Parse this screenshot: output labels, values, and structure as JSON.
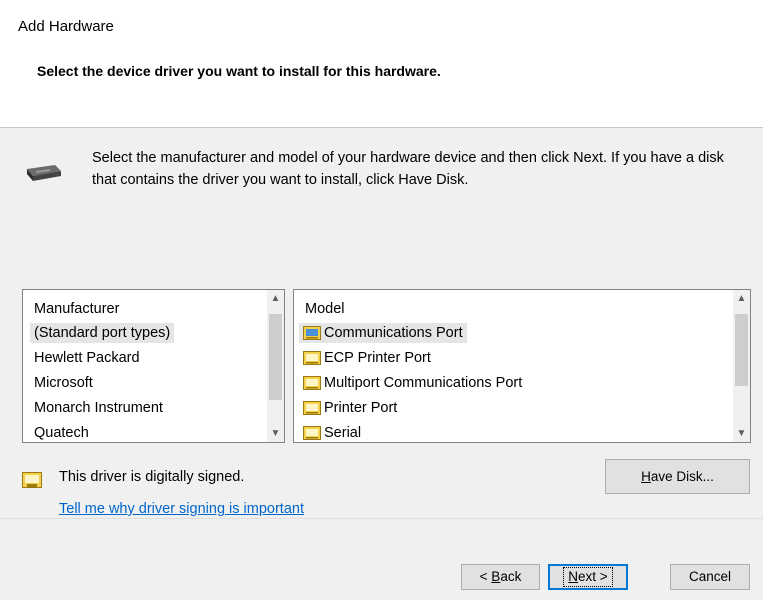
{
  "window": {
    "title": "Add Hardware"
  },
  "header": {
    "heading": "Select the device driver you want to install for this hardware."
  },
  "instructions": "Select the manufacturer and model of your hardware device and then click Next. If you have a disk that contains the driver you want to install, click Have Disk.",
  "manufacturer_list": {
    "header": "Manufacturer",
    "items": [
      "(Standard port types)",
      "Hewlett Packard",
      "Microsoft",
      "Monarch Instrument",
      "Quatech"
    ],
    "selected": "(Standard port types)"
  },
  "model_list": {
    "header": "Model",
    "items": [
      "Communications Port",
      "ECP Printer Port",
      "Multiport Communications Port",
      "Printer Port",
      "Serial"
    ],
    "selected": "Communications Port"
  },
  "signing": {
    "status": "This driver is digitally signed.",
    "link": "Tell me why driver signing is important"
  },
  "buttons": {
    "have_disk": {
      "pre": "",
      "key": "H",
      "post": "ave Disk..."
    },
    "back": {
      "pre": "< ",
      "key": "B",
      "post": "ack"
    },
    "next": {
      "pre": "",
      "key": "N",
      "post": "ext >"
    },
    "cancel": "Cancel"
  },
  "colors": {
    "accent": "#0078d7",
    "link": "#0066cc",
    "selection": "#e5e5e5"
  }
}
